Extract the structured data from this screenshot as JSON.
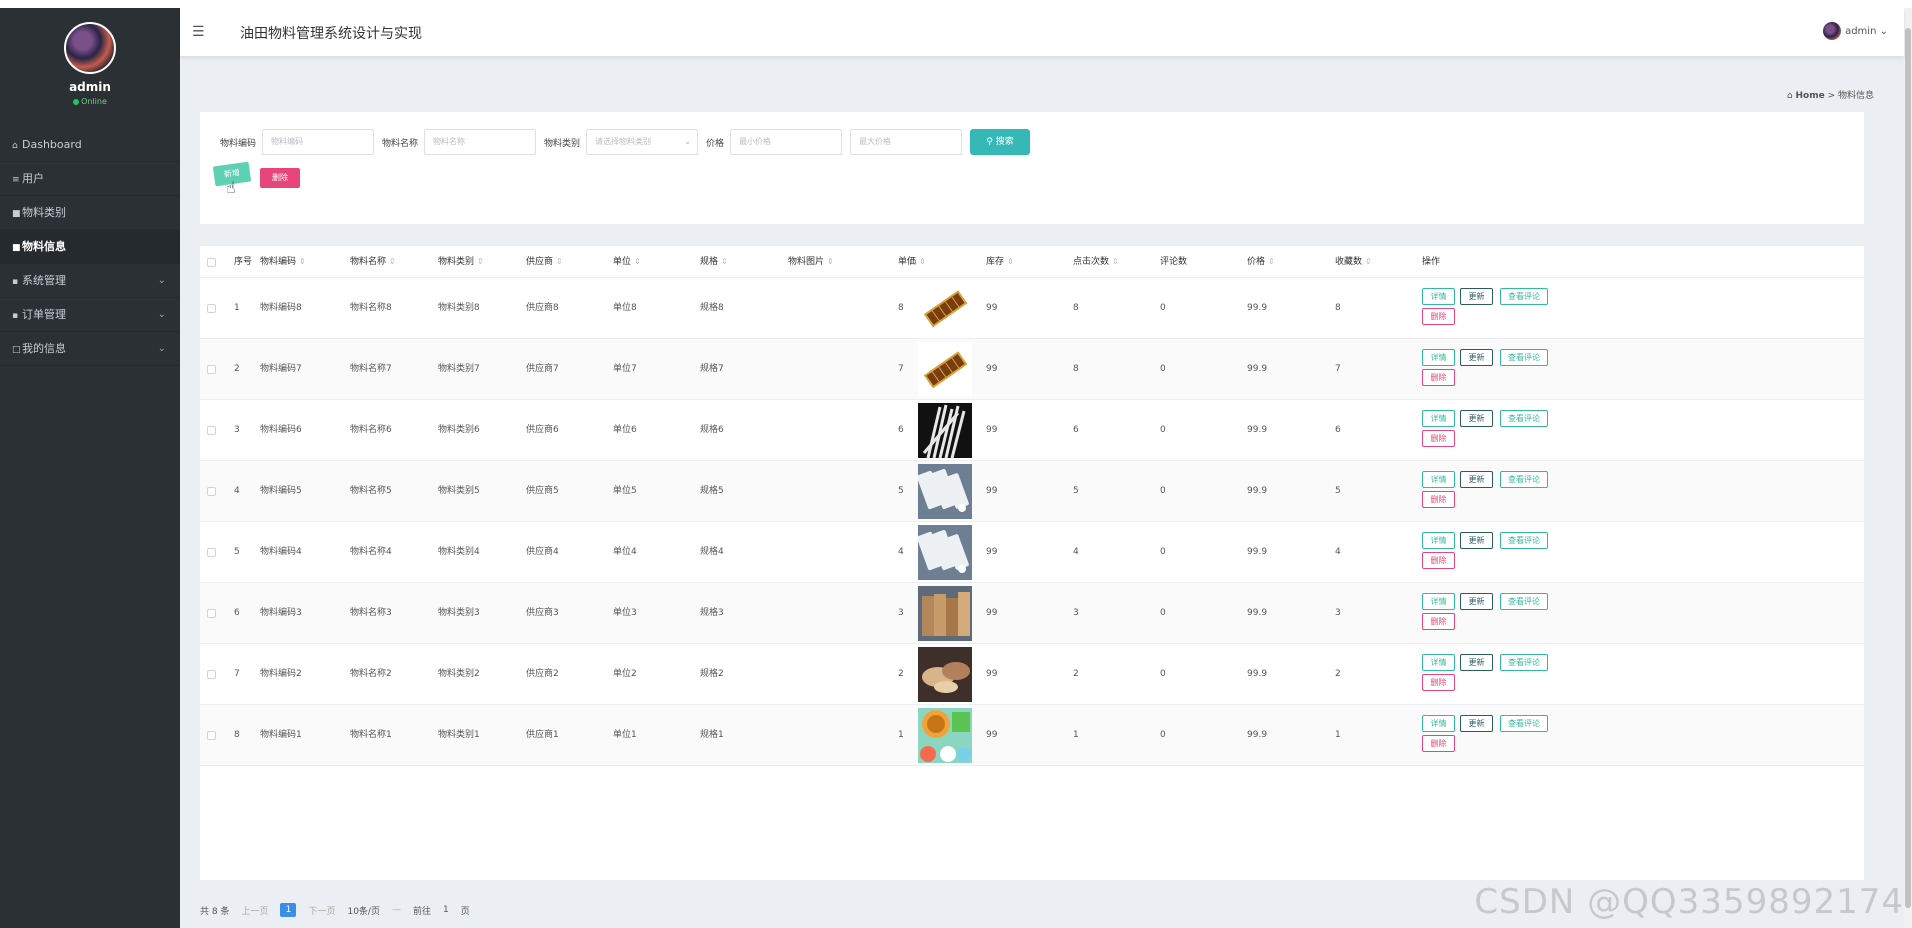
{
  "sidebar": {
    "user": "admin",
    "status": "Online",
    "items": [
      {
        "label": "Dashboard",
        "icon": "⌂"
      },
      {
        "label": "用户",
        "icon": "≡"
      },
      {
        "label": "物料类别",
        "icon": "■"
      },
      {
        "label": "物料信息",
        "icon": "■"
      },
      {
        "label": "系统管理",
        "icon": "▪"
      },
      {
        "label": "订单管理",
        "icon": "▪"
      },
      {
        "label": "我的信息",
        "icon": "□"
      }
    ]
  },
  "topbar": {
    "title": "油田物料管理系统设计与实现",
    "user": "admin"
  },
  "breadcrumb": {
    "home": "Home",
    "sep": ">",
    "current": "物料信息"
  },
  "search": {
    "code_label": "物料编码",
    "code_placeholder": "物料编码",
    "name_label": "物料名称",
    "name_placeholder": "物料名称",
    "type_label": "物料类别",
    "type_placeholder": "请选择物料类别",
    "price_label": "价格",
    "min_placeholder": "最小价格",
    "max_placeholder": "最大价格",
    "search_button": "搜索",
    "add_button": "新增",
    "delete_button": "删除"
  },
  "table": {
    "headers": [
      "序号",
      "物料编码",
      "物料名称",
      "物料类别",
      "供应商",
      "单位",
      "规格",
      "物料图片",
      "单価",
      "库存",
      "点击次数",
      "评论数",
      "价格",
      "收藏数",
      "操作"
    ],
    "rows": [
      {
        "idx": "1",
        "code": "物料编码8",
        "name": "物料名称8",
        "type": "物料类别8",
        "supplier": "供应商8",
        "unit": "单位8",
        "spec": "规格8",
        "image": "chocolate",
        "unit_price": "8",
        "stock": "99",
        "clicks": "8",
        "comments": "0",
        "price": "99.9",
        "favs": "8"
      },
      {
        "idx": "2",
        "code": "物料编码7",
        "name": "物料名称7",
        "type": "物料类别7",
        "supplier": "供应商7",
        "unit": "单位7",
        "spec": "规格7",
        "image": "chocolate",
        "unit_price": "7",
        "stock": "99",
        "clicks": "8",
        "comments": "0",
        "price": "99.9",
        "favs": "7"
      },
      {
        "idx": "3",
        "code": "物料编码6",
        "name": "物料名称6",
        "type": "物料类别6",
        "supplier": "供应商6",
        "unit": "单位6",
        "spec": "规格6",
        "image": "straws",
        "unit_price": "6",
        "stock": "99",
        "clicks": "6",
        "comments": "0",
        "price": "99.9",
        "favs": "6"
      },
      {
        "idx": "4",
        "code": "物料编码5",
        "name": "物料名称5",
        "type": "物料类别5",
        "supplier": "供应商5",
        "unit": "单位5",
        "spec": "规格5",
        "image": "packs",
        "unit_price": "5",
        "stock": "99",
        "clicks": "5",
        "comments": "0",
        "price": "99.9",
        "favs": "5"
      },
      {
        "idx": "5",
        "code": "物料编码4",
        "name": "物料名称4",
        "type": "物料类别4",
        "supplier": "供应商4",
        "unit": "单位4",
        "spec": "规格4",
        "image": "packs",
        "unit_price": "4",
        "stock": "99",
        "clicks": "4",
        "comments": "0",
        "price": "99.9",
        "favs": "4"
      },
      {
        "idx": "6",
        "code": "物料编码3",
        "name": "物料名称3",
        "type": "物料类别3",
        "supplier": "供应商3",
        "unit": "单位3",
        "spec": "规格3",
        "image": "bags",
        "unit_price": "3",
        "stock": "99",
        "clicks": "3",
        "comments": "0",
        "price": "99.9",
        "favs": "3"
      },
      {
        "idx": "7",
        "code": "物料编码2",
        "name": "物料名称2",
        "type": "物料类别2",
        "supplier": "供应商2",
        "unit": "单位2",
        "spec": "规格2",
        "image": "food",
        "unit_price": "2",
        "stock": "99",
        "clicks": "2",
        "comments": "0",
        "price": "99.9",
        "favs": "2"
      },
      {
        "idx": "8",
        "code": "物料编码1",
        "name": "物料名称1",
        "type": "物料类别1",
        "supplier": "供应商1",
        "unit": "单位1",
        "spec": "规格1",
        "image": "bowls",
        "unit_price": "1",
        "stock": "99",
        "clicks": "1",
        "comments": "0",
        "price": "99.9",
        "favs": "1"
      }
    ],
    "ops": {
      "detail": "详情",
      "update": "更新",
      "review": "查看评论",
      "remove": "删除"
    }
  },
  "pager": {
    "total": "共 8 条",
    "prev": "上一页",
    "page": "1",
    "next": "下一页",
    "size": "10条/页",
    "goto": "前往",
    "goto_page": "1",
    "unit": "页"
  },
  "watermark": "CSDN @QQ3359892174"
}
